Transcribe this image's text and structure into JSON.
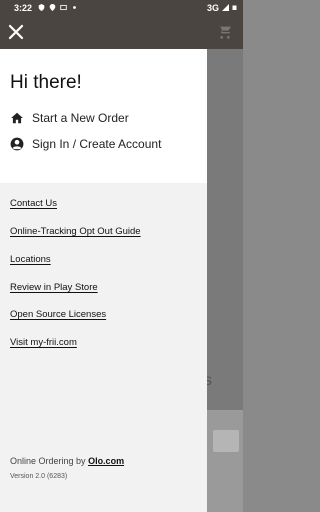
{
  "status_bar": {
    "time": "3:22",
    "network": "3G"
  },
  "drawer": {
    "greeting": "Hi there!",
    "menu": [
      {
        "label": "Start a New Order",
        "icon": "home-icon"
      },
      {
        "label": "Sign In / Create Account",
        "icon": "account-icon"
      }
    ],
    "links": [
      "Contact Us",
      "Online-Tracking Opt Out Guide",
      "Locations",
      "Review in Play Store",
      "Open Source Licenses",
      "Visit my-frii.com"
    ],
    "footer_prefix": "Online Ordering by",
    "footer_link": "Olo.com",
    "version": "Version 2.0 (6283)"
  },
  "background": {
    "partial_text": "s"
  }
}
